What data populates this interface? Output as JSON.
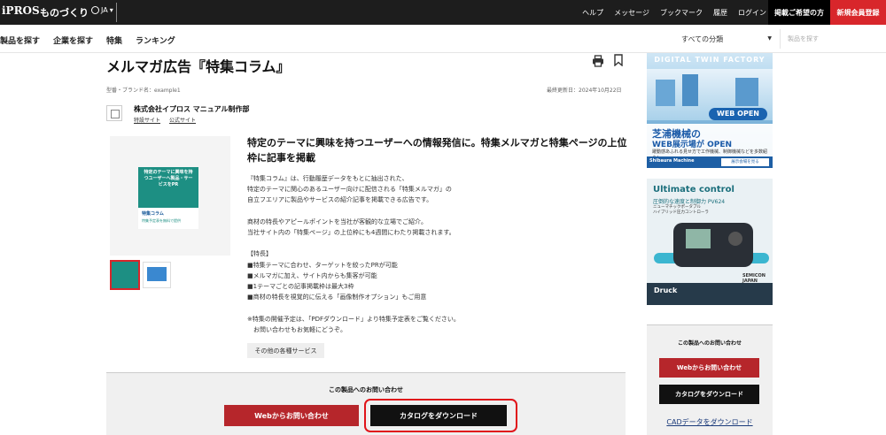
{
  "header": {
    "logo": "iPROS",
    "logo_sub": "ものづくり",
    "lang": "JA",
    "nav": [
      "ヘルプ",
      "メッセージ",
      "ブックマーク",
      "履歴",
      "ログイン"
    ],
    "request_button": "掲載ご希望の方",
    "register_button": "新規会員登録"
  },
  "subnav": {
    "items": [
      "製品を探す",
      "企業を探す",
      "特集",
      "ランキング"
    ],
    "category_select": "すべての分類",
    "search_placeholder": "製品を探す"
  },
  "page": {
    "title": "メルマガ広告『特集コラム』",
    "brand_line": "型番・ブランド名：example1",
    "updated": "最終更新日：2024年10月22日",
    "company_name": "株式会社イプロス マニュアル制作部",
    "company_links": [
      "特設サイト",
      "公式サイト"
    ]
  },
  "product": {
    "card_text": "特定のテーマに興味を持つユーザーへ製品・サービスをPR",
    "card_band_1": "特集コラム",
    "card_band_2": "特集予定表を無料で提供",
    "heading": "特定のテーマに興味を持つユーザーへの情報発信に。特集メルマガと特集ページの上位枠に記事を掲載",
    "body": [
      "『特集コラム』は、行動履歴データをもとに抽出された、",
      "特定のテーマに関心のあるユーザー向けに配信される「特集メルマガ」の",
      "自立フエリアに製品やサービスの紹介記事を掲載できる広告です。",
      "",
      "商材の特長やアピールポイントを当社が客観的な立場でご紹介。",
      "当社サイト内の「特集ページ」の上位枠にも4週間にわたり掲載されます。",
      "",
      "【特長】",
      "■特集テーマに合わせ、ターゲットを絞ったPRが可能",
      "■メルマガに加え、サイト内からも集客が可能",
      "■1テーマごとの記事掲載枠は最大3枠",
      "■商材の特長を視覚的に伝える「画像制作オプション」もご用意",
      "",
      "※特集の開催予定は、「PDFダウンロード」より特集予定表をご覧ください。",
      "　お問い合わせもお気軽にどうぞ。"
    ],
    "other_services": "その他の各種サービス"
  },
  "contact": {
    "title": "この製品へのお問い合わせ",
    "web_button": "Webからお問い合わせ",
    "catalog_button": "カタログをダウンロード"
  },
  "ads": {
    "ad1": {
      "heading": "DIGITAL TWIN FACTORY",
      "pill": "WEB OPEN",
      "line1": "芝浦機械の",
      "line2": "WEB展示場が OPEN",
      "line3": "躍動感あふれる見せ方で工作機械、制御機械などを多数紹介！",
      "brand": "Shibaura Machine",
      "cta": "展示会場を見る"
    },
    "ad2": {
      "heading": "Ultimate control",
      "sub1": "圧倒的な速度と制御力 PV624",
      "sub2": "ニューマチックポータブル",
      "sub3": "ハイブリッド圧力コントローラ",
      "event": "SEMICON JAPAN",
      "brand": "Druck"
    }
  },
  "sidebar_contact": {
    "title": "この製品へのお問い合わせ",
    "web_button": "Webからお問い合わせ",
    "catalog_button": "カタログをダウンロード",
    "cad_link": "CADデータをダウンロード"
  }
}
